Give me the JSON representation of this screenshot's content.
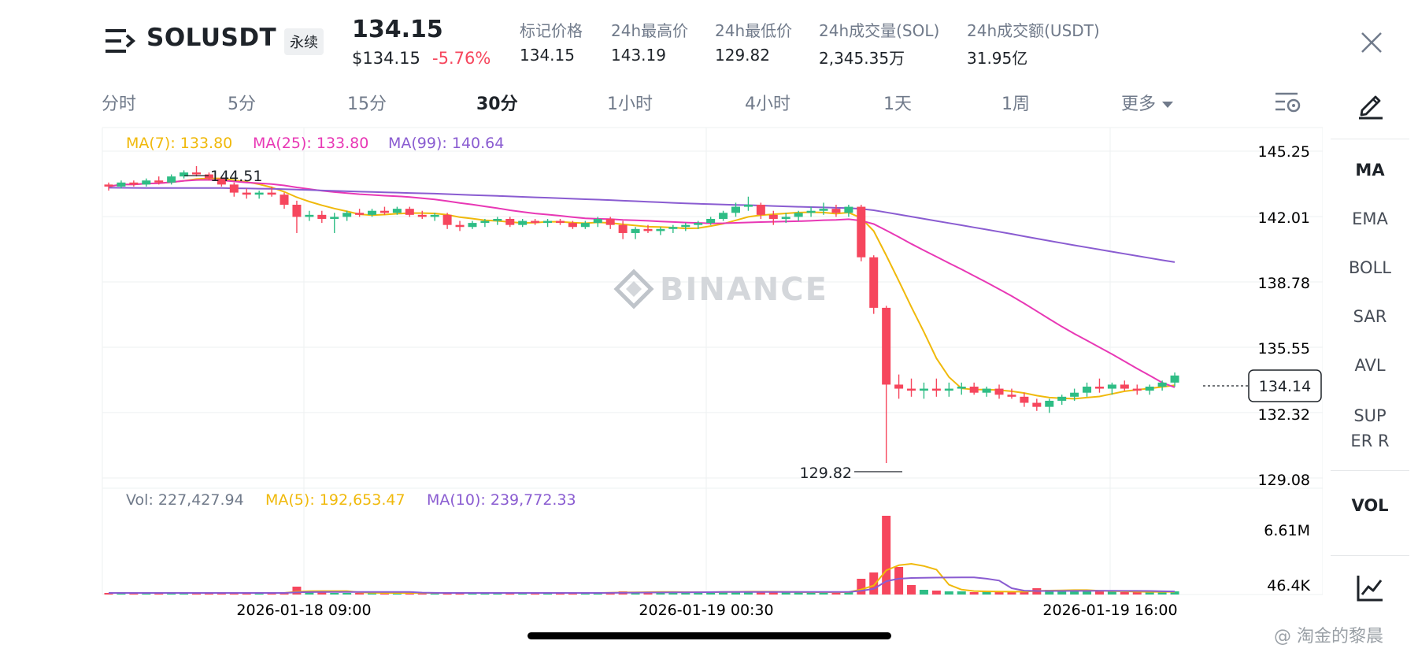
{
  "header": {
    "symbol": "SOLUSDT",
    "contract_type": "永续",
    "last_price": "134.15",
    "usd_price": "$134.15",
    "change_pct": "-5.76%",
    "stats": [
      {
        "label": "标记价格",
        "value": "134.15"
      },
      {
        "label": "24h最高价",
        "value": "143.19"
      },
      {
        "label": "24h最低价",
        "value": "129.82"
      },
      {
        "label": "24h成交量(SOL)",
        "value": "2,345.35万"
      },
      {
        "label": "24h成交额(USDT)",
        "value": "31.95亿"
      }
    ]
  },
  "intervals": [
    "分时",
    "5分",
    "15分",
    "30分",
    "1小时",
    "4小时",
    "1天",
    "1周",
    "更多"
  ],
  "active_interval": "30分",
  "indicators": [
    "MA",
    "EMA",
    "BOLL",
    "SAR",
    "AVL",
    "SUPER R",
    "VOL"
  ],
  "active_indicators": [
    "MA",
    "VOL"
  ],
  "colors": {
    "up": "#2ebd85",
    "down": "#f6465d",
    "ma7": "#f0b90b",
    "ma25": "#e838b5",
    "ma99": "#8a5cd1",
    "text_secondary": "#707a8a"
  },
  "chart_data": {
    "type": "candlestick",
    "symbol": "SOLUSDT",
    "interval": "30分",
    "price_ticks": [
      "145.25",
      "142.01",
      "138.78",
      "135.55",
      "132.32",
      "129.08"
    ],
    "time_ticks": [
      "2026-01-18 09:00",
      "2026-01-19 00:30",
      "2026-01-19 16:00"
    ],
    "ylim": [
      129.08,
      145.25
    ],
    "volume_ticks": [
      "6.61M",
      "46.4K"
    ],
    "current_price_label": "134.14",
    "high_marker": "144.51",
    "low_marker": "129.82",
    "ma_legend": [
      {
        "name": "MA(7)",
        "value": "133.80"
      },
      {
        "name": "MA(25)",
        "value": "133.80"
      },
      {
        "name": "MA(99)",
        "value": "140.64"
      }
    ],
    "vol_legend": [
      {
        "name": "Vol",
        "value": "227,427.94"
      },
      {
        "name": "MA(5)",
        "value": "192,653.47"
      },
      {
        "name": "MA(10)",
        "value": "239,772.33"
      }
    ],
    "candles": [
      [
        143.6,
        143.7,
        143.3,
        143.5
      ],
      [
        143.5,
        143.8,
        143.4,
        143.7
      ],
      [
        143.7,
        143.8,
        143.5,
        143.6
      ],
      [
        143.6,
        143.9,
        143.5,
        143.8
      ],
      [
        143.8,
        144.0,
        143.6,
        143.7
      ],
      [
        143.7,
        144.1,
        143.6,
        144.0
      ],
      [
        144.0,
        144.3,
        143.9,
        144.2
      ],
      [
        144.2,
        144.51,
        144.0,
        144.1
      ],
      [
        144.1,
        144.2,
        143.8,
        143.9
      ],
      [
        143.9,
        144.0,
        143.5,
        143.6
      ],
      [
        143.6,
        143.7,
        143.0,
        143.2
      ],
      [
        143.2,
        143.4,
        142.9,
        143.1
      ],
      [
        143.1,
        143.3,
        142.9,
        143.2
      ],
      [
        143.2,
        143.5,
        143.0,
        143.1
      ],
      [
        143.1,
        143.2,
        142.4,
        142.6
      ],
      [
        142.6,
        142.8,
        141.2,
        142.0
      ],
      [
        142.0,
        142.3,
        141.8,
        142.1
      ],
      [
        142.1,
        142.3,
        141.7,
        141.9
      ],
      [
        141.9,
        142.2,
        141.2,
        142.0
      ],
      [
        142.0,
        142.3,
        141.8,
        142.2
      ],
      [
        142.2,
        142.4,
        142.0,
        142.1
      ],
      [
        142.1,
        142.4,
        142.0,
        142.3
      ],
      [
        142.3,
        142.5,
        142.1,
        142.2
      ],
      [
        142.2,
        142.5,
        142.1,
        142.4
      ],
      [
        142.4,
        142.5,
        142.0,
        142.1
      ],
      [
        142.1,
        142.3,
        141.9,
        142.0
      ],
      [
        142.0,
        142.2,
        141.8,
        142.1
      ],
      [
        142.1,
        142.2,
        141.4,
        141.6
      ],
      [
        141.6,
        141.8,
        141.3,
        141.5
      ],
      [
        141.5,
        141.8,
        141.4,
        141.7
      ],
      [
        141.7,
        141.9,
        141.5,
        141.8
      ],
      [
        141.8,
        142.0,
        141.6,
        141.9
      ],
      [
        141.9,
        142.0,
        141.5,
        141.6
      ],
      [
        141.6,
        141.9,
        141.5,
        141.8
      ],
      [
        141.8,
        141.9,
        141.6,
        141.7
      ],
      [
        141.7,
        141.9,
        141.5,
        141.8
      ],
      [
        141.8,
        141.9,
        141.6,
        141.7
      ],
      [
        141.7,
        141.8,
        141.4,
        141.5
      ],
      [
        141.5,
        141.8,
        141.4,
        141.7
      ],
      [
        141.7,
        142.0,
        141.5,
        141.9
      ],
      [
        141.9,
        142.0,
        141.4,
        141.6
      ],
      [
        141.6,
        141.8,
        140.9,
        141.2
      ],
      [
        141.2,
        141.5,
        140.9,
        141.4
      ],
      [
        141.4,
        141.6,
        141.2,
        141.3
      ],
      [
        141.3,
        141.5,
        141.1,
        141.4
      ],
      [
        141.4,
        141.6,
        141.2,
        141.5
      ],
      [
        141.5,
        141.7,
        141.3,
        141.6
      ],
      [
        141.6,
        141.8,
        141.4,
        141.7
      ],
      [
        141.7,
        142.0,
        141.6,
        141.9
      ],
      [
        141.9,
        142.3,
        141.8,
        142.2
      ],
      [
        142.2,
        142.7,
        142.0,
        142.5
      ],
      [
        142.5,
        143.0,
        142.3,
        142.6
      ],
      [
        142.6,
        142.7,
        141.9,
        142.1
      ],
      [
        142.1,
        142.3,
        141.6,
        141.9
      ],
      [
        141.9,
        142.2,
        141.7,
        142.0
      ],
      [
        142.0,
        142.3,
        141.8,
        142.2
      ],
      [
        142.2,
        142.5,
        142.0,
        142.3
      ],
      [
        142.3,
        142.7,
        142.1,
        142.4
      ],
      [
        142.4,
        142.6,
        142.0,
        142.2
      ],
      [
        142.2,
        142.6,
        142.0,
        142.5
      ],
      [
        142.5,
        142.6,
        139.8,
        140.0
      ],
      [
        140.0,
        140.1,
        137.2,
        137.5
      ],
      [
        137.5,
        137.6,
        129.82,
        133.7
      ],
      [
        133.7,
        134.2,
        133.0,
        133.5
      ],
      [
        133.5,
        134.0,
        133.1,
        133.4
      ],
      [
        133.4,
        133.8,
        133.0,
        133.5
      ],
      [
        133.5,
        134.0,
        133.1,
        133.4
      ],
      [
        133.4,
        133.8,
        133.1,
        133.5
      ],
      [
        133.5,
        133.8,
        133.2,
        133.6
      ],
      [
        133.6,
        133.8,
        133.2,
        133.3
      ],
      [
        133.3,
        133.6,
        133.1,
        133.5
      ],
      [
        133.5,
        133.7,
        133.0,
        133.2
      ],
      [
        133.2,
        133.5,
        133.0,
        133.1
      ],
      [
        133.1,
        133.3,
        132.6,
        132.8
      ],
      [
        132.8,
        133.0,
        132.4,
        132.6
      ],
      [
        132.6,
        133.0,
        132.3,
        132.9
      ],
      [
        132.9,
        133.2,
        132.7,
        133.1
      ],
      [
        133.1,
        133.5,
        132.9,
        133.3
      ],
      [
        133.3,
        133.8,
        133.1,
        133.6
      ],
      [
        133.6,
        134.0,
        133.3,
        133.5
      ],
      [
        133.5,
        133.8,
        133.2,
        133.7
      ],
      [
        133.7,
        133.9,
        133.4,
        133.5
      ],
      [
        133.5,
        133.7,
        133.2,
        133.4
      ],
      [
        133.4,
        133.7,
        133.2,
        133.6
      ],
      [
        133.6,
        133.9,
        133.4,
        133.8
      ],
      [
        133.8,
        134.3,
        133.6,
        134.15
      ]
    ],
    "volume_relative": [
      0.02,
      0.02,
      0.02,
      0.02,
      0.02,
      0.02,
      0.02,
      0.02,
      0.02,
      0.02,
      0.02,
      0.02,
      0.02,
      0.02,
      0.02,
      0.1,
      0.05,
      0.03,
      0.02,
      0.02,
      0.02,
      0.02,
      0.02,
      0.02,
      0.02,
      0.02,
      0.02,
      0.02,
      0.02,
      0.02,
      0.02,
      0.02,
      0.02,
      0.02,
      0.02,
      0.02,
      0.02,
      0.02,
      0.02,
      0.02,
      0.03,
      0.04,
      0.03,
      0.03,
      0.03,
      0.03,
      0.03,
      0.03,
      0.03,
      0.04,
      0.04,
      0.04,
      0.03,
      0.03,
      0.03,
      0.03,
      0.03,
      0.03,
      0.03,
      0.03,
      0.2,
      0.28,
      1.0,
      0.35,
      0.12,
      0.06,
      0.05,
      0.04,
      0.04,
      0.03,
      0.04,
      0.04,
      0.03,
      0.04,
      0.08,
      0.06,
      0.05,
      0.05,
      0.04,
      0.04,
      0.04,
      0.03,
      0.03,
      0.03,
      0.04,
      0.04
    ]
  },
  "watermark": "BINANCE",
  "credit": "@ 淘金的黎晨"
}
